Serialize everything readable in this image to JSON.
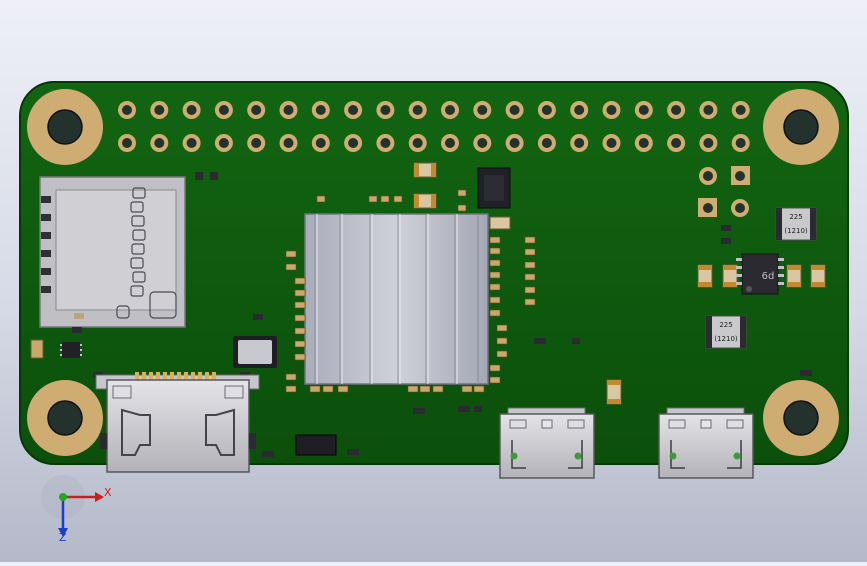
{
  "axes": {
    "x_label": "X",
    "z_label": "Z"
  },
  "components": {
    "inductor_top": "225\n(1210)",
    "inductor_bottom": "225\n(1210)",
    "regulator_marking": "6d",
    "colors": {
      "board": "#0e5a0e",
      "pad_ring": "#c9a86a",
      "heatsink": "#b9bcc8",
      "connector_metal": "#c8c8cc"
    }
  }
}
